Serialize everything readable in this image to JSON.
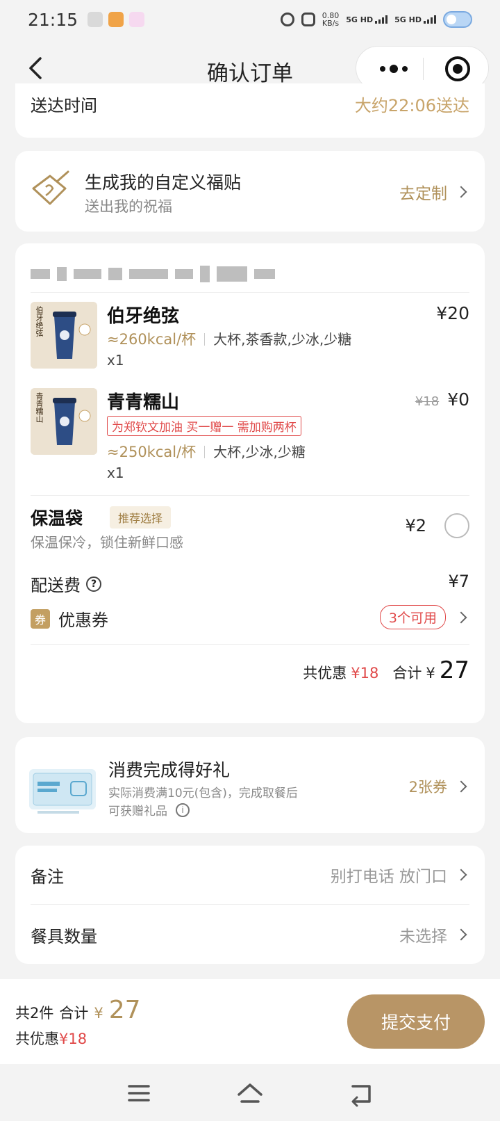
{
  "status_bar": {
    "time": "21:15",
    "speed_value": "0.80",
    "speed_unit": "KB/s",
    "sim1": "5G HD",
    "sim2": "5G HD"
  },
  "nav": {
    "title": "确认订单"
  },
  "delivery": {
    "label": "送达时间",
    "value": "大约22:06送达"
  },
  "blessing": {
    "title": "生成我的自定义福贴",
    "subtitle": "送出我的祝福",
    "action": "去定制"
  },
  "order": {
    "items": [
      {
        "name": "伯牙绝弦",
        "price": "¥20",
        "kcal": "≈260kcal/杯",
        "options": "大杯,茶香款,少冰,少糖",
        "qty": "x1",
        "thumb_text": "伯牙绝弦"
      },
      {
        "name": "青青糯山",
        "old_price": "¥18",
        "price": "¥0",
        "promo": "为郑钦文加油 买一赠一 需加购两杯",
        "kcal": "≈250kcal/杯",
        "options": "大杯,少冰,少糖",
        "qty": "x1",
        "thumb_text": "青青糯山"
      }
    ],
    "bag": {
      "title": "保温袋",
      "tag": "推荐选择",
      "subtitle": "保温保冷，锁住新鲜口感",
      "price": "¥2"
    },
    "delivery_fee": {
      "label": "配送费",
      "value": "¥7"
    },
    "coupon": {
      "badge": "券",
      "label": "优惠券",
      "available": "3个可用"
    },
    "summary": {
      "discount_label": "共优惠",
      "discount_value": "¥18",
      "total_label": "合计",
      "currency": "¥",
      "total_value": "27"
    }
  },
  "gift": {
    "title": "消费完成得好礼",
    "line1": "实际消费满10元(包含)，完成取餐后",
    "line2": "可获赠礼品",
    "action": "2张券"
  },
  "notes": {
    "remark_label": "备注",
    "remark_value": "别打电话 放门口",
    "utensils_label": "餐具数量",
    "utensils_value": "未选择"
  },
  "bottom": {
    "count": "共2件",
    "total_label": "合计",
    "currency": "¥",
    "total_value": "27",
    "discount_label": "共优惠",
    "discount_value": "¥18",
    "pay_button": "提交支付"
  },
  "colors": {
    "accent_gold": "#b0915a",
    "pay_button": "#b89566",
    "discount_red": "#e04848"
  }
}
